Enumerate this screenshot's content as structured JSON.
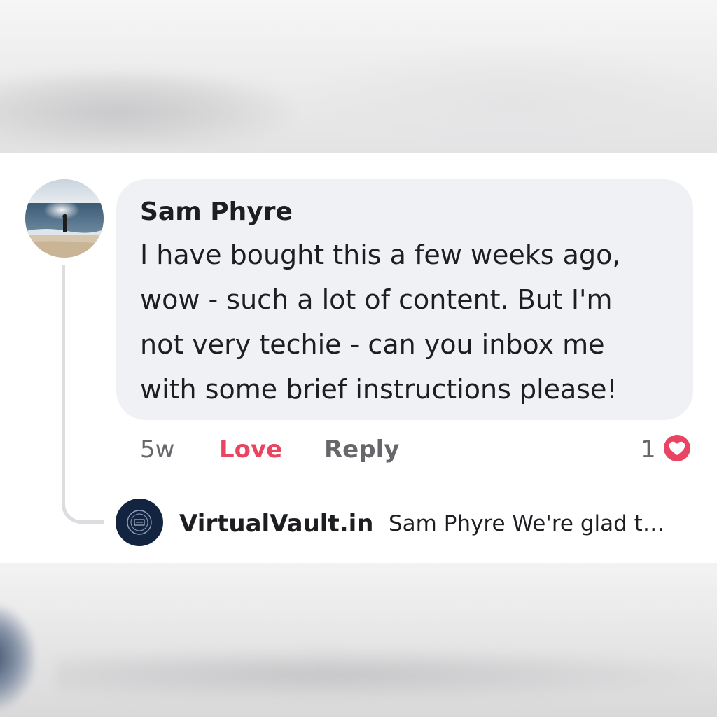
{
  "comment": {
    "author": "Sam Phyre",
    "lines": [
      "I have bought this a few weeks ago,",
      "wow - such a lot of content. But I'm",
      "not very techie - can you inbox me",
      "with some brief instructions please!"
    ],
    "time": "5w",
    "love_label": "Love",
    "reply_label": "Reply",
    "reaction_count": "1",
    "reaction_icon": "heart-icon",
    "love_color": "#e94461",
    "bubble_color": "#f0f1f4"
  },
  "reply": {
    "author": "VirtualVault.in",
    "preview": "Sam Phyre We're glad t…",
    "avatar_color": "#132440"
  }
}
